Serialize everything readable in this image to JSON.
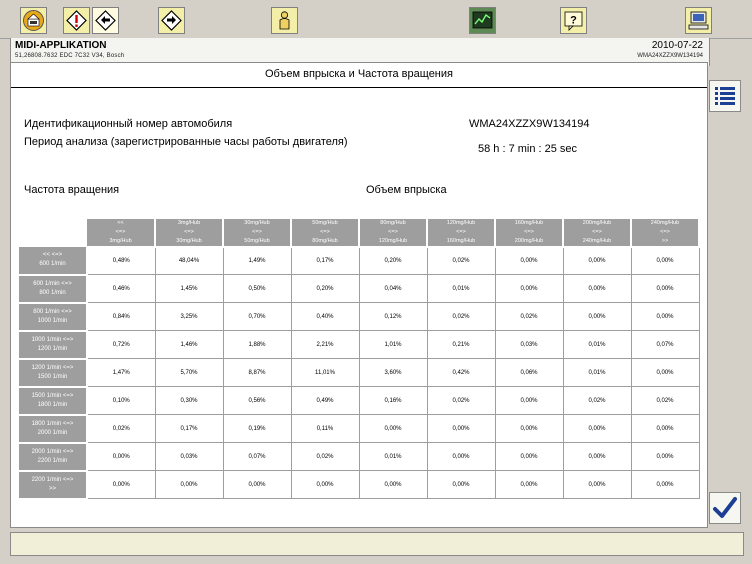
{
  "app": {
    "title": "MIDI-APPLIKATION",
    "subtitle": "51,26808.7632  EDC 7C32 V34, Bosch",
    "date": "2010-07-22",
    "vin_small": "WMA24XZZX9W134194"
  },
  "page": {
    "title": "Объем впрыска и Частота вращения",
    "vin_label": "Идентификационный номер автомобиля",
    "vin_value": "WMA24XZZX9W134194",
    "period_label": "Период анализа (зарегистрированные часы работы двигателя)",
    "period_value": "58 h : 7 min : 25 sec",
    "rpm_section": "Частота вращения",
    "injection_section": "Объем впрыска"
  },
  "table": {
    "columns": [
      {
        "l1": "<<",
        "l2": "<=>",
        "l3": "3mg/Hub"
      },
      {
        "l1": "3mg/Hub",
        "l2": "<=>",
        "l3": "30mg/Hub"
      },
      {
        "l1": "30mg/Hub",
        "l2": "<=>",
        "l3": "50mg/Hub"
      },
      {
        "l1": "50mg/Hub",
        "l2": "<=>",
        "l3": "80mg/Hub"
      },
      {
        "l1": "80mg/Hub",
        "l2": "<=>",
        "l3": "120mg/Hub"
      },
      {
        "l1": "120mg/Hub",
        "l2": "<=>",
        "l3": "160mg/Hub"
      },
      {
        "l1": "160mg/Hub",
        "l2": "<=>",
        "l3": "200mg/Hub"
      },
      {
        "l1": "200mg/Hub",
        "l2": "<=>",
        "l3": "240mg/Hub"
      },
      {
        "l1": "240mg/Hub",
        "l2": "<=>",
        "l3": ">>"
      }
    ],
    "rows": [
      {
        "l1": "<< <=>",
        "l2": "600 1/min",
        "values": [
          "0,48%",
          "48,04%",
          "1,49%",
          "0,17%",
          "0,20%",
          "0,02%",
          "0,00%",
          "0,00%",
          "0,00%"
        ]
      },
      {
        "l1": "600 1/min <=>",
        "l2": "800 1/min",
        "values": [
          "0,46%",
          "1,45%",
          "0,50%",
          "0,20%",
          "0,04%",
          "0,01%",
          "0,00%",
          "0,00%",
          "0,00%"
        ]
      },
      {
        "l1": "800 1/min <=>",
        "l2": "1000 1/min",
        "values": [
          "0,84%",
          "3,25%",
          "0,70%",
          "0,40%",
          "0,12%",
          "0,02%",
          "0,02%",
          "0,00%",
          "0,00%"
        ]
      },
      {
        "l1": "1000 1/min <=>",
        "l2": "1200 1/min",
        "values": [
          "0,72%",
          "1,46%",
          "1,88%",
          "2,21%",
          "1,01%",
          "0,21%",
          "0,03%",
          "0,01%",
          "0,07%"
        ]
      },
      {
        "l1": "1200 1/min <=>",
        "l2": "1500 1/min",
        "values": [
          "1,47%",
          "5,70%",
          "8,87%",
          "11,01%",
          "3,60%",
          "0,42%",
          "0,06%",
          "0,01%",
          "0,00%"
        ]
      },
      {
        "l1": "1500 1/min <=>",
        "l2": "1800 1/min",
        "values": [
          "0,10%",
          "0,30%",
          "0,56%",
          "0,49%",
          "0,16%",
          "0,02%",
          "0,00%",
          "0,02%",
          "0,02%"
        ]
      },
      {
        "l1": "1800 1/min <=>",
        "l2": "2000 1/min",
        "values": [
          "0,02%",
          "0,17%",
          "0,19%",
          "0,11%",
          "0,00%",
          "0,00%",
          "0,00%",
          "0,00%",
          "0,00%"
        ]
      },
      {
        "l1": "2000 1/min <=>",
        "l2": "2200 1/min",
        "values": [
          "0,00%",
          "0,03%",
          "0,07%",
          "0,02%",
          "0,01%",
          "0,00%",
          "0,00%",
          "0,00%",
          "0,00%"
        ]
      },
      {
        "l1": "2200 1/min <=>",
        "l2": ">>",
        "values": [
          "0,00%",
          "0,00%",
          "0,00%",
          "0,00%",
          "0,00%",
          "0,00%",
          "0,00%",
          "0,00%",
          "0,00%"
        ]
      }
    ]
  },
  "toolbar": {
    "icons": [
      "home-icon",
      "warning-icon",
      "back-icon",
      "forward-icon",
      "person-icon",
      "graph-icon",
      "help-icon",
      "computer-icon"
    ],
    "help_glyph": "?"
  },
  "colors": {
    "toolbar_bg": "#d4d0c8",
    "button_yellow": "#f3efa8",
    "header_cell": "#9e9e9e",
    "accent_blue": "#1c3f94"
  }
}
